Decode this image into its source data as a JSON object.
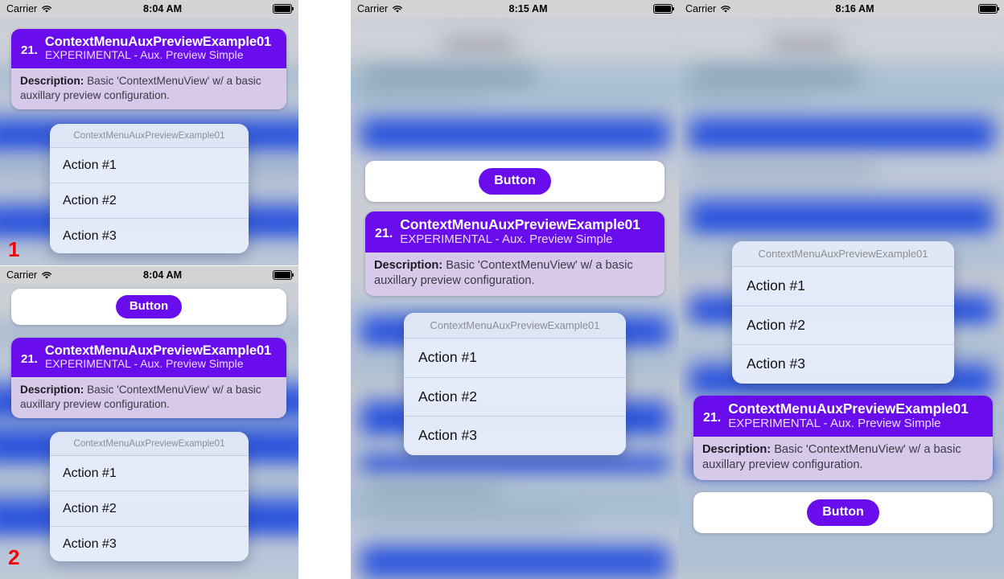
{
  "status_bars": {
    "carrier_label": "Carrier",
    "wifi_icon": "wifi-icon",
    "battery_icon": "battery-full-icon",
    "time_a": "8:04 AM",
    "time_b": "8:04 AM",
    "time_c": "8:15 AM",
    "time_d": "8:16 AM"
  },
  "example_card": {
    "index": "21.",
    "title": "ContextMenuAuxPreviewExample01",
    "subtitle": "EXPERIMENTAL - Aux. Preview Simple",
    "description_label": "Description:",
    "description_text": " Basic 'ContextMenuView' w/ a basic auxillary preview configuration."
  },
  "button_card": {
    "label": "Button"
  },
  "context_menu": {
    "title": "ContextMenuAuxPreviewExample01",
    "items": [
      {
        "label": "Action #1"
      },
      {
        "label": "Action #2"
      },
      {
        "label": "Action #3"
      }
    ]
  },
  "markers": {
    "one": "1",
    "two": "2"
  },
  "colors": {
    "brand_purple": "#6a0ded",
    "description_lavender": "#d6c9e9",
    "marker_red": "#f20505",
    "status_bar_gray": "#d3d3d6",
    "menu_fill": "#ecf0fa"
  }
}
